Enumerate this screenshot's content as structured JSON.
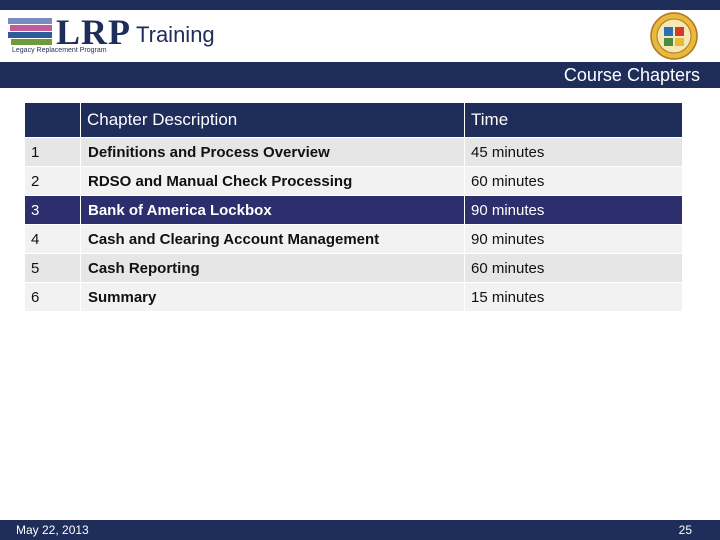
{
  "header": {
    "logo_text": "LRP",
    "logo_subtitle": "Legacy Replacement Program",
    "title": "Training"
  },
  "banner": {
    "section_title": "Course Chapters"
  },
  "table": {
    "columns": [
      "",
      "Chapter Description",
      "Time"
    ],
    "rows": [
      {
        "num": "1",
        "description": "Definitions and Process Overview",
        "time": "45 minutes"
      },
      {
        "num": "2",
        "description": "RDSO and Manual Check Processing",
        "time": "60 minutes"
      },
      {
        "num": "3",
        "description": "Bank of America Lockbox",
        "time": "90 minutes"
      },
      {
        "num": "4",
        "description": "Cash and Clearing Account Management",
        "time": "90 minutes"
      },
      {
        "num": "5",
        "description": "Cash Reporting",
        "time": "60 minutes"
      },
      {
        "num": "6",
        "description": "Summary",
        "time": "15 minutes"
      }
    ],
    "highlighted_row": "3"
  },
  "footer": {
    "date": "May 22, 2013",
    "page_number": "25"
  },
  "colors": {
    "navy": "#1f2d5a",
    "highlight": "#2d2e6e",
    "row_light": "#f2f2f2",
    "row_dark": "#e6e6e6"
  }
}
